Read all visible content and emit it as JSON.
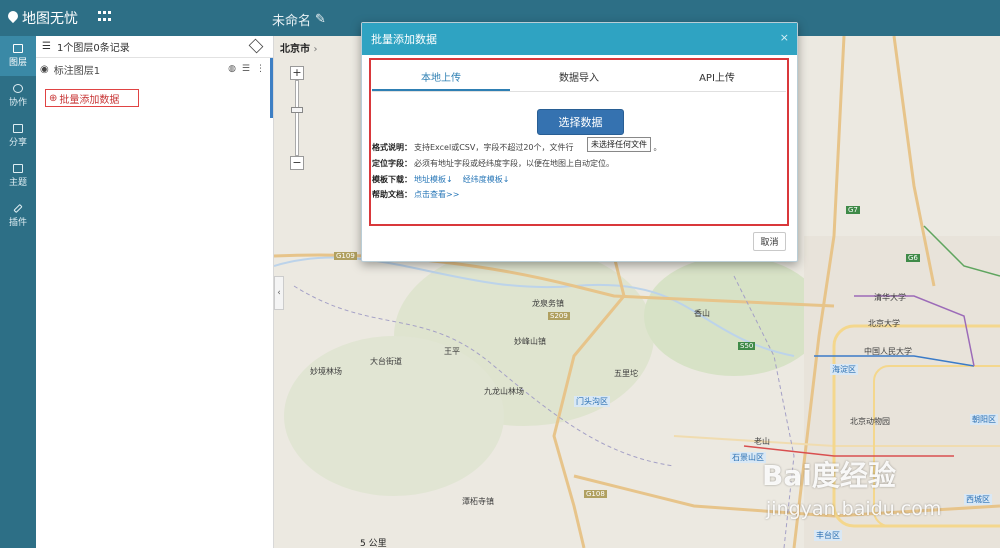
{
  "app": {
    "title": "地图无忧",
    "doc_title": "未命名"
  },
  "nav": [
    {
      "label": "图层",
      "active": true
    },
    {
      "label": "协作",
      "active": false
    },
    {
      "label": "分享",
      "active": false
    },
    {
      "label": "主题",
      "active": false
    },
    {
      "label": "插件",
      "active": false
    }
  ],
  "layer_panel": {
    "summary": "1个图层0条记录",
    "layer_name": "标注图层1",
    "add_button": "批量添加数据"
  },
  "map": {
    "city": "北京市",
    "labels": [
      "妙峰山镇",
      "大台街道",
      "龙泉务镇",
      "九龙山林场",
      "妙境林场",
      "王平",
      "五里坨",
      "门头沟区",
      "石景山区",
      "海淀区",
      "西城区",
      "朝阳区",
      "丰台区",
      "中国人民大学",
      "清华大学",
      "北京大学",
      "香山",
      "北京动物园",
      "老山",
      "潭柘寺镇",
      "5 公里"
    ],
    "road_tags": [
      "G109",
      "G108",
      "S209",
      "S50",
      "G7",
      "G6"
    ]
  },
  "modal": {
    "title": "批量添加数据",
    "close": "×",
    "tabs": [
      "本地上传",
      "数据导入",
      "API上传"
    ],
    "active_tab": 0,
    "choose_button": "选择数据",
    "tooltip": "未选择任何文件",
    "format_label": "格式说明：",
    "format_text": "支持Excel或CSV，字段不超过20个，文件行",
    "format_tail": "。",
    "locate_label": "定位字段：",
    "locate_text": "必须有地址字段或经纬度字段，以便在地图上自动定位。",
    "template_label": "模板下载：",
    "template_link1": "地址模板↓",
    "template_link2": "经纬度模板↓",
    "help_label": "帮助文档：",
    "help_link": "点击查看>>",
    "cancel": "取消"
  },
  "watermark": {
    "brand": "Bai度经验",
    "cn": "经验",
    "url": "jingyan.baidu.com"
  },
  "colors": {
    "header": "#2d6f86",
    "modal_header": "#2fa3c2",
    "primary_button": "#3572b0",
    "highlight": "#d9383b"
  }
}
